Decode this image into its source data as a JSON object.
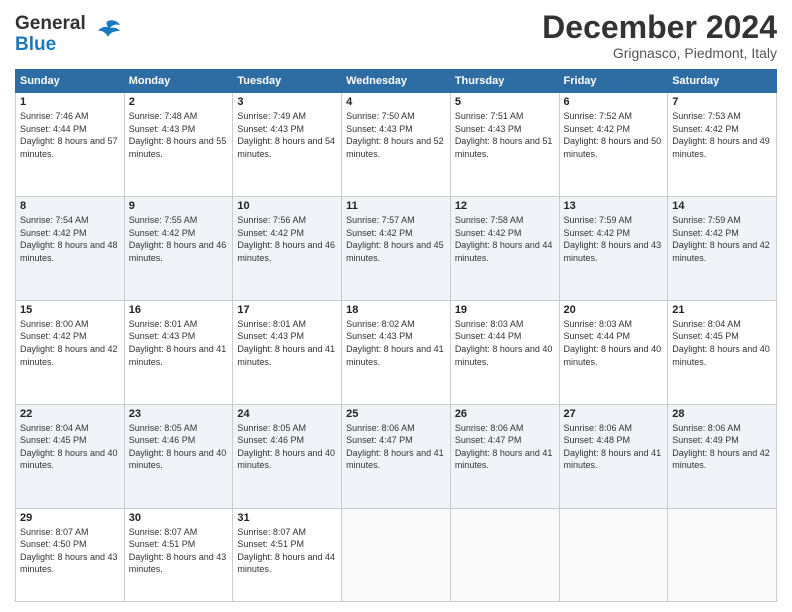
{
  "header": {
    "logo_line1": "General",
    "logo_line2": "Blue",
    "month": "December 2024",
    "location": "Grignasco, Piedmont, Italy"
  },
  "weekdays": [
    "Sunday",
    "Monday",
    "Tuesday",
    "Wednesday",
    "Thursday",
    "Friday",
    "Saturday"
  ],
  "weeks": [
    [
      {
        "day": "1",
        "sunrise": "7:46 AM",
        "sunset": "4:44 PM",
        "daylight": "8 hours and 57 minutes."
      },
      {
        "day": "2",
        "sunrise": "7:48 AM",
        "sunset": "4:43 PM",
        "daylight": "8 hours and 55 minutes."
      },
      {
        "day": "3",
        "sunrise": "7:49 AM",
        "sunset": "4:43 PM",
        "daylight": "8 hours and 54 minutes."
      },
      {
        "day": "4",
        "sunrise": "7:50 AM",
        "sunset": "4:43 PM",
        "daylight": "8 hours and 52 minutes."
      },
      {
        "day": "5",
        "sunrise": "7:51 AM",
        "sunset": "4:43 PM",
        "daylight": "8 hours and 51 minutes."
      },
      {
        "day": "6",
        "sunrise": "7:52 AM",
        "sunset": "4:42 PM",
        "daylight": "8 hours and 50 minutes."
      },
      {
        "day": "7",
        "sunrise": "7:53 AM",
        "sunset": "4:42 PM",
        "daylight": "8 hours and 49 minutes."
      }
    ],
    [
      {
        "day": "8",
        "sunrise": "7:54 AM",
        "sunset": "4:42 PM",
        "daylight": "8 hours and 48 minutes."
      },
      {
        "day": "9",
        "sunrise": "7:55 AM",
        "sunset": "4:42 PM",
        "daylight": "8 hours and 46 minutes."
      },
      {
        "day": "10",
        "sunrise": "7:56 AM",
        "sunset": "4:42 PM",
        "daylight": "8 hours and 46 minutes."
      },
      {
        "day": "11",
        "sunrise": "7:57 AM",
        "sunset": "4:42 PM",
        "daylight": "8 hours and 45 minutes."
      },
      {
        "day": "12",
        "sunrise": "7:58 AM",
        "sunset": "4:42 PM",
        "daylight": "8 hours and 44 minutes."
      },
      {
        "day": "13",
        "sunrise": "7:59 AM",
        "sunset": "4:42 PM",
        "daylight": "8 hours and 43 minutes."
      },
      {
        "day": "14",
        "sunrise": "7:59 AM",
        "sunset": "4:42 PM",
        "daylight": "8 hours and 42 minutes."
      }
    ],
    [
      {
        "day": "15",
        "sunrise": "8:00 AM",
        "sunset": "4:42 PM",
        "daylight": "8 hours and 42 minutes."
      },
      {
        "day": "16",
        "sunrise": "8:01 AM",
        "sunset": "4:43 PM",
        "daylight": "8 hours and 41 minutes."
      },
      {
        "day": "17",
        "sunrise": "8:01 AM",
        "sunset": "4:43 PM",
        "daylight": "8 hours and 41 minutes."
      },
      {
        "day": "18",
        "sunrise": "8:02 AM",
        "sunset": "4:43 PM",
        "daylight": "8 hours and 41 minutes."
      },
      {
        "day": "19",
        "sunrise": "8:03 AM",
        "sunset": "4:44 PM",
        "daylight": "8 hours and 40 minutes."
      },
      {
        "day": "20",
        "sunrise": "8:03 AM",
        "sunset": "4:44 PM",
        "daylight": "8 hours and 40 minutes."
      },
      {
        "day": "21",
        "sunrise": "8:04 AM",
        "sunset": "4:45 PM",
        "daylight": "8 hours and 40 minutes."
      }
    ],
    [
      {
        "day": "22",
        "sunrise": "8:04 AM",
        "sunset": "4:45 PM",
        "daylight": "8 hours and 40 minutes."
      },
      {
        "day": "23",
        "sunrise": "8:05 AM",
        "sunset": "4:46 PM",
        "daylight": "8 hours and 40 minutes."
      },
      {
        "day": "24",
        "sunrise": "8:05 AM",
        "sunset": "4:46 PM",
        "daylight": "8 hours and 40 minutes."
      },
      {
        "day": "25",
        "sunrise": "8:06 AM",
        "sunset": "4:47 PM",
        "daylight": "8 hours and 41 minutes."
      },
      {
        "day": "26",
        "sunrise": "8:06 AM",
        "sunset": "4:47 PM",
        "daylight": "8 hours and 41 minutes."
      },
      {
        "day": "27",
        "sunrise": "8:06 AM",
        "sunset": "4:48 PM",
        "daylight": "8 hours and 41 minutes."
      },
      {
        "day": "28",
        "sunrise": "8:06 AM",
        "sunset": "4:49 PM",
        "daylight": "8 hours and 42 minutes."
      }
    ],
    [
      {
        "day": "29",
        "sunrise": "8:07 AM",
        "sunset": "4:50 PM",
        "daylight": "8 hours and 43 minutes."
      },
      {
        "day": "30",
        "sunrise": "8:07 AM",
        "sunset": "4:51 PM",
        "daylight": "8 hours and 43 minutes."
      },
      {
        "day": "31",
        "sunrise": "8:07 AM",
        "sunset": "4:51 PM",
        "daylight": "8 hours and 44 minutes."
      },
      null,
      null,
      null,
      null
    ]
  ]
}
